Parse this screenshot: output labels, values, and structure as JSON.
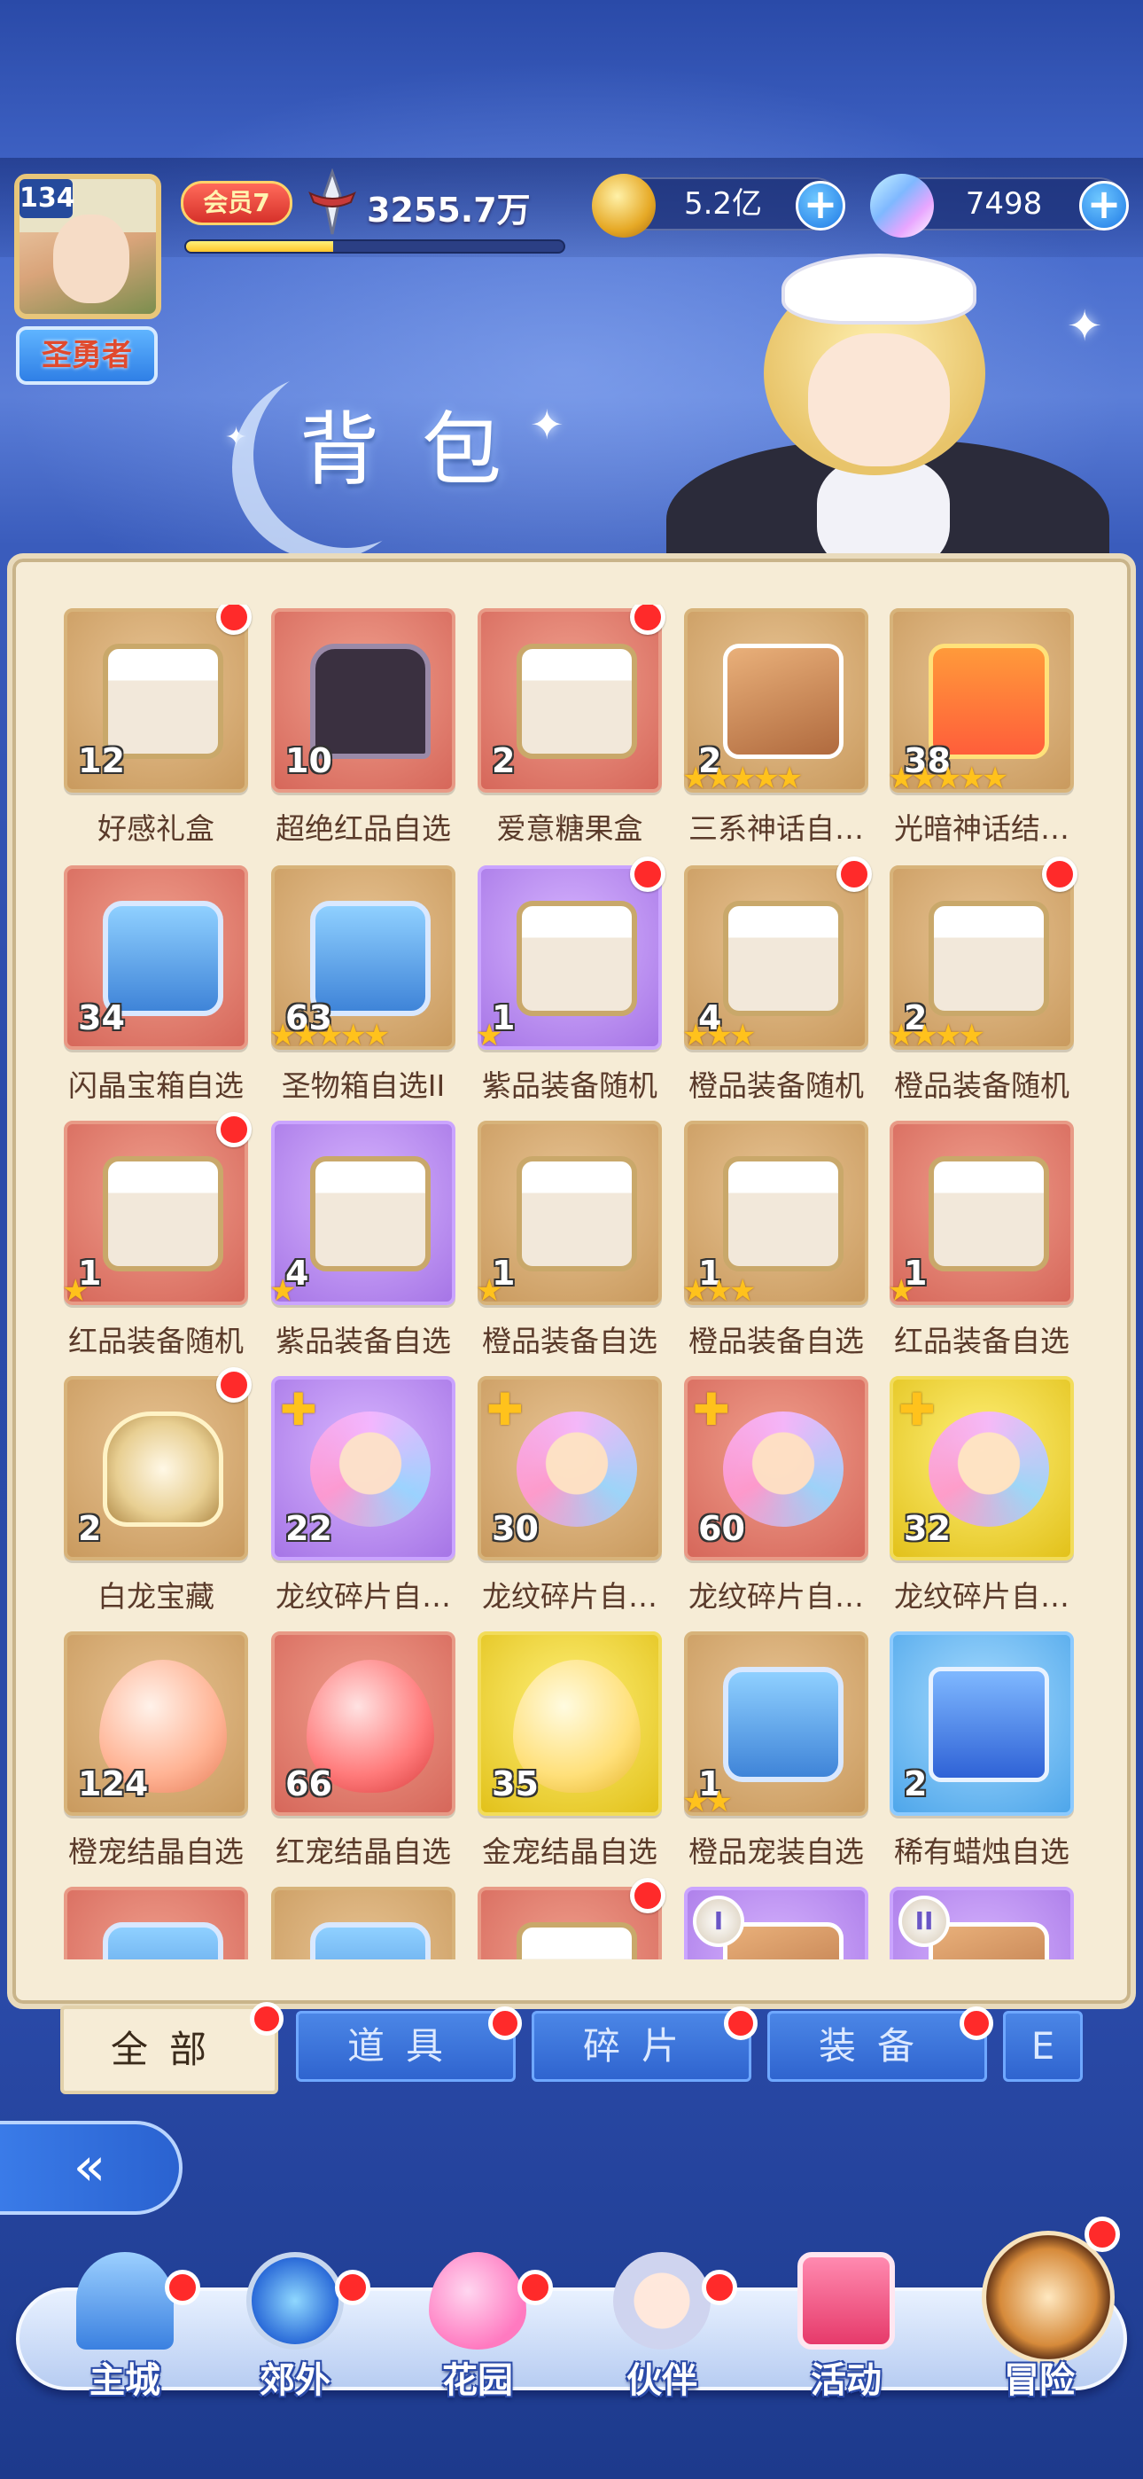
{
  "player": {
    "level": "134",
    "title": "圣勇者",
    "vip": "会员7",
    "power": "3255.7万",
    "exp_progress": 0.39
  },
  "currency": {
    "gold": "5.2亿",
    "gems": "7498"
  },
  "page_title": "背包",
  "items": [
    {
      "name": "好感礼盒",
      "count": "12",
      "stars": 0,
      "quality": "gold",
      "art": "box",
      "dot": true
    },
    {
      "name": "超绝红品自选",
      "count": "10",
      "stars": 0,
      "quality": "red",
      "art": "coffin",
      "dot": false
    },
    {
      "name": "爱意糖果盒",
      "count": "2",
      "stars": 0,
      "quality": "red",
      "art": "box",
      "dot": true
    },
    {
      "name": "三系神话自…",
      "count": "2",
      "stars": 5,
      "quality": "gold",
      "art": "cards",
      "dot": false
    },
    {
      "name": "光暗神话结…",
      "count": "38",
      "stars": 5,
      "quality": "gold",
      "art": "gift",
      "dot": false
    },
    {
      "name": "闪晶宝箱自选",
      "count": "34",
      "stars": 0,
      "quality": "red",
      "art": "chest",
      "dot": false
    },
    {
      "name": "圣物箱自选II",
      "count": "63",
      "stars": 5,
      "quality": "gold",
      "art": "chest",
      "dot": false
    },
    {
      "name": "紫品装备随机",
      "count": "1",
      "stars": 1,
      "quality": "purple",
      "art": "box",
      "dot": true
    },
    {
      "name": "橙品装备随机",
      "count": "4",
      "stars": 3,
      "quality": "gold",
      "art": "box",
      "dot": true
    },
    {
      "name": "橙品装备随机",
      "count": "2",
      "stars": 4,
      "quality": "gold",
      "art": "box",
      "dot": true
    },
    {
      "name": "红品装备随机",
      "count": "1",
      "stars": 1,
      "quality": "red",
      "art": "box",
      "dot": true
    },
    {
      "name": "紫品装备自选",
      "count": "4",
      "stars": 1,
      "quality": "purple",
      "art": "box",
      "dot": false
    },
    {
      "name": "橙品装备自选",
      "count": "1",
      "stars": 1,
      "quality": "gold",
      "art": "box",
      "dot": false
    },
    {
      "name": "橙品装备自选",
      "count": "1",
      "stars": 3,
      "quality": "gold",
      "art": "box",
      "dot": false
    },
    {
      "name": "红品装备自选",
      "count": "1",
      "stars": 1,
      "quality": "red",
      "art": "box",
      "dot": false
    },
    {
      "name": "白龙宝藏",
      "count": "2",
      "stars": 0,
      "quality": "gold",
      "art": "dragon",
      "dot": true
    },
    {
      "name": "龙纹碎片自…",
      "count": "22",
      "stars": 0,
      "quality": "purple",
      "art": "frag",
      "dot": false,
      "puzzle": true
    },
    {
      "name": "龙纹碎片自…",
      "count": "30",
      "stars": 0,
      "quality": "gold",
      "art": "frag",
      "dot": false,
      "puzzle": true
    },
    {
      "name": "龙纹碎片自…",
      "count": "60",
      "stars": 0,
      "quality": "red",
      "art": "frag",
      "dot": false,
      "puzzle": true
    },
    {
      "name": "龙纹碎片自…",
      "count": "32",
      "stars": 0,
      "quality": "yellow",
      "art": "frag",
      "dot": false,
      "puzzle": true
    },
    {
      "name": "橙宠结晶自选",
      "count": "124",
      "stars": 0,
      "quality": "gold",
      "art": "egg-orange",
      "dot": false
    },
    {
      "name": "红宠结晶自选",
      "count": "66",
      "stars": 0,
      "quality": "red",
      "art": "egg-red",
      "dot": false
    },
    {
      "name": "金宠结晶自选",
      "count": "35",
      "stars": 0,
      "quality": "yellow",
      "art": "egg-gold",
      "dot": false
    },
    {
      "name": "橙品宠装自选",
      "count": "1",
      "stars": 2,
      "quality": "gold",
      "art": "chest",
      "dot": false
    },
    {
      "name": "稀有蜡烛自选",
      "count": "2",
      "stars": 0,
      "quality": "blue",
      "art": "candle",
      "dot": false
    },
    {
      "name": "",
      "count": "",
      "stars": 0,
      "quality": "red",
      "art": "chest",
      "dot": false
    },
    {
      "name": "",
      "count": "",
      "stars": 0,
      "quality": "gold",
      "art": "chest",
      "dot": false
    },
    {
      "name": "",
      "count": "",
      "stars": 0,
      "quality": "red",
      "art": "box",
      "dot": true
    },
    {
      "name": "",
      "count": "",
      "stars": 0,
      "quality": "purple",
      "art": "cards",
      "dot": false,
      "badge": "I"
    },
    {
      "name": "",
      "count": "",
      "stars": 0,
      "quality": "purple",
      "art": "cards",
      "dot": false,
      "badge": "II"
    }
  ],
  "tabs": [
    {
      "label": "全部",
      "active": true,
      "dot": true
    },
    {
      "label": "道具",
      "active": false,
      "dot": true
    },
    {
      "label": "碎片",
      "active": false,
      "dot": true
    },
    {
      "label": "装备",
      "active": false,
      "dot": true
    },
    {
      "label": "E",
      "active": false,
      "dot": false
    }
  ],
  "nav": {
    "main_city": "主城",
    "outskirts": "郊外",
    "garden": "花园",
    "partner": "伙伴",
    "activity": "活动",
    "adventure": "冒险"
  },
  "colors": {
    "badge_red": "#ff2a2a",
    "star": "#ffc21c",
    "panel": "#f6ecd6"
  }
}
